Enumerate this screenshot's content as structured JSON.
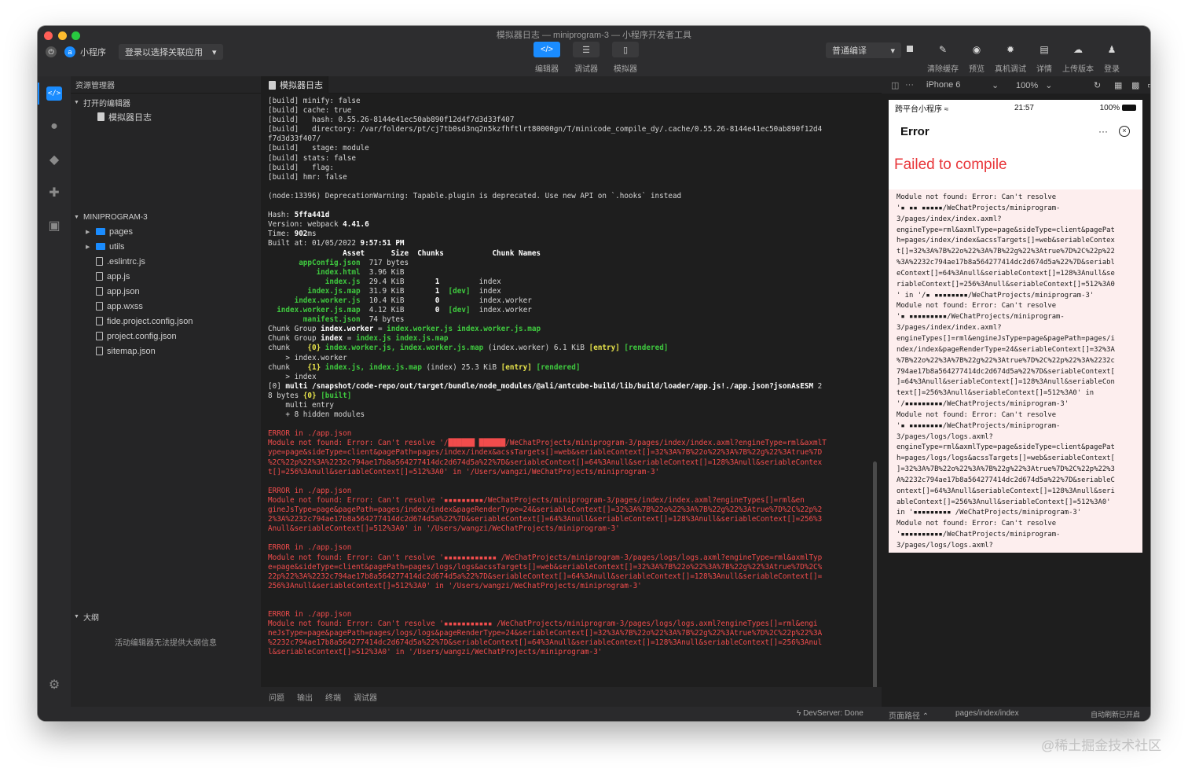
{
  "window": {
    "title": "模拟器日志 — miniprogram-3 — 小程序开发者工具"
  },
  "toolbar": {
    "app_label": "小程序",
    "project_select": "登录以选择关联应用",
    "modes": [
      {
        "icon": "code-icon",
        "label": "编辑器",
        "active": true
      },
      {
        "icon": "sliders-icon",
        "label": "调试器",
        "active": false
      },
      {
        "icon": "phone-icon",
        "label": "模拟器",
        "active": false
      }
    ],
    "compile_mode": "普通编译",
    "actions": [
      {
        "icon": "broom-icon",
        "label": "清除缓存"
      },
      {
        "icon": "eye-icon",
        "label": "预览"
      },
      {
        "icon": "bug-icon",
        "label": "真机调试"
      },
      {
        "icon": "document-icon",
        "label": "详情"
      },
      {
        "icon": "cloud-upload-icon",
        "label": "上传版本"
      },
      {
        "icon": "user-icon",
        "label": "登录"
      }
    ]
  },
  "explorer": {
    "header": "资源管理器",
    "open_editors_label": "打开的编辑器",
    "open_editors": [
      "模拟器日志"
    ],
    "project_label": "MINIPROGRAM-3",
    "files": [
      {
        "name": "pages",
        "type": "folder"
      },
      {
        "name": "utils",
        "type": "folder"
      },
      {
        "name": ".eslintrc.js",
        "type": "file"
      },
      {
        "name": "app.js",
        "type": "file"
      },
      {
        "name": "app.json",
        "type": "file"
      },
      {
        "name": "app.wxss",
        "type": "file"
      },
      {
        "name": "fide.project.config.json",
        "type": "file"
      },
      {
        "name": "project.config.json",
        "type": "file"
      },
      {
        "name": "sitemap.json",
        "type": "file"
      }
    ],
    "outline_label": "大纲",
    "outline_message": "活动编辑器无法提供大纲信息"
  },
  "editor": {
    "tab_label": "模拟器日志",
    "console_lines": [
      [
        {
          "t": "[build] minify: false"
        }
      ],
      [
        {
          "t": "[build] cache: true"
        }
      ],
      [
        {
          "t": "[build]   hash: 0.55.26-8144e41ec50ab890f12d4f7d3d33f407"
        }
      ],
      [
        {
          "t": "[build]   directory: /var/folders/pt/cj7tb0sd3nq2n5kzfhftlrt80000gn/T/minicode_compile_dy/.cache/0.55.26-8144e41ec50ab890f12d4"
        }
      ],
      [
        {
          "t": "f7d3d33f407/"
        }
      ],
      [
        {
          "t": "[build]   stage: module"
        }
      ],
      [
        {
          "t": "[build] stats: false"
        }
      ],
      [
        {
          "t": "[build]   flag:"
        }
      ],
      [
        {
          "t": "[build] hmr: false"
        }
      ],
      [
        {
          "t": ""
        }
      ],
      [
        {
          "t": "(node:13396) DeprecationWarning: Tapable.plugin is deprecated. Use new API on `.hooks` instead"
        }
      ],
      [
        {
          "t": ""
        }
      ],
      [
        {
          "t": "Hash: "
        },
        {
          "t": "5ffa441d",
          "c": "b"
        }
      ],
      [
        {
          "t": "Version: webpack "
        },
        {
          "t": "4.41.6",
          "c": "b"
        }
      ],
      [
        {
          "t": "Time: "
        },
        {
          "t": "902",
          "c": "b"
        },
        {
          "t": "ms"
        }
      ],
      [
        {
          "t": "Built at: 01/05/2022 "
        },
        {
          "t": "9:57:51 PM",
          "c": "b"
        }
      ],
      [
        {
          "t": "                 Asset      Size  Chunks           Chunk Names",
          "c": "b"
        }
      ],
      [
        {
          "t": "       "
        },
        {
          "t": "appConfig.json",
          "c": "green"
        },
        {
          "t": "  717 bytes"
        }
      ],
      [
        {
          "t": "           "
        },
        {
          "t": "index.html",
          "c": "green"
        },
        {
          "t": "  3.96 KiB"
        }
      ],
      [
        {
          "t": "             "
        },
        {
          "t": "index.js",
          "c": "green"
        },
        {
          "t": "  29.4 KiB       "
        },
        {
          "t": "1",
          "c": "b"
        },
        {
          "t": "         index"
        }
      ],
      [
        {
          "t": "         "
        },
        {
          "t": "index.js.map",
          "c": "green"
        },
        {
          "t": "  31.9 KiB       "
        },
        {
          "t": "1",
          "c": "b"
        },
        {
          "t": "  "
        },
        {
          "t": "[dev]",
          "c": "green"
        },
        {
          "t": "  index"
        }
      ],
      [
        {
          "t": "      "
        },
        {
          "t": "index.worker.js",
          "c": "green"
        },
        {
          "t": "  10.4 KiB       "
        },
        {
          "t": "0",
          "c": "b"
        },
        {
          "t": "         index.worker"
        }
      ],
      [
        {
          "t": "  "
        },
        {
          "t": "index.worker.js.map",
          "c": "green"
        },
        {
          "t": "  4.12 KiB       "
        },
        {
          "t": "0",
          "c": "b"
        },
        {
          "t": "  "
        },
        {
          "t": "[dev]",
          "c": "green"
        },
        {
          "t": "  index.worker"
        }
      ],
      [
        {
          "t": "        "
        },
        {
          "t": "manifest.json",
          "c": "green"
        },
        {
          "t": "  74 bytes"
        }
      ],
      [
        {
          "t": "Chunk Group "
        },
        {
          "t": "index.worker",
          "c": "b"
        },
        {
          "t": " = "
        },
        {
          "t": "index.worker.js index.worker.js.map",
          "c": "green"
        }
      ],
      [
        {
          "t": "Chunk Group "
        },
        {
          "t": "index",
          "c": "b"
        },
        {
          "t": " = "
        },
        {
          "t": "index.js index.js.map",
          "c": "green"
        }
      ],
      [
        {
          "t": "chunk    "
        },
        {
          "t": "{0}",
          "c": "yellow"
        },
        {
          "t": " "
        },
        {
          "t": "index.worker.js, index.worker.js.map",
          "c": "green"
        },
        {
          "t": " (index.worker) 6.1 KiB "
        },
        {
          "t": "[entry]",
          "c": "yellow"
        },
        {
          "t": " "
        },
        {
          "t": "[rendered]",
          "c": "green"
        }
      ],
      [
        {
          "t": "    > index.worker"
        }
      ],
      [
        {
          "t": "chunk    "
        },
        {
          "t": "{1}",
          "c": "yellow"
        },
        {
          "t": " "
        },
        {
          "t": "index.js, index.js.map",
          "c": "green"
        },
        {
          "t": " (index) 25.3 KiB "
        },
        {
          "t": "[entry]",
          "c": "yellow"
        },
        {
          "t": " "
        },
        {
          "t": "[rendered]",
          "c": "green"
        }
      ],
      [
        {
          "t": "    > index"
        }
      ],
      [
        {
          "t": "[0] "
        },
        {
          "t": "multi /snapshot/code-repo/out/target/bundle/node_modules/@ali/antcube-build/lib/build/loader/app.js!./app.json?jsonAsESM",
          "c": "b"
        },
        {
          "t": " 2"
        }
      ],
      [
        {
          "t": "8 bytes "
        },
        {
          "t": "{0}",
          "c": "yellow"
        },
        {
          "t": " "
        },
        {
          "t": "[built]",
          "c": "green"
        }
      ],
      [
        {
          "t": "    multi entry"
        }
      ],
      [
        {
          "t": "    + 8 hidden modules"
        }
      ],
      [
        {
          "t": ""
        }
      ],
      [
        {
          "t": "ERROR in ./app.json",
          "c": "red"
        }
      ],
      [
        {
          "t": "Module not found: Error: Can't resolve '/██████ ██████/WeChatProjects/miniprogram-3/pages/index/index.axml?engineType=rml&axmlT",
          "c": "red"
        }
      ],
      [
        {
          "t": "ype=page&sideType=client&pagePath=pages/index/index&acssTargets[]=web&seriableContext[]=32%3A%7B%22o%22%3A%7B%22g%22%3Atrue%7D",
          "c": "red"
        }
      ],
      [
        {
          "t": "%2C%22p%22%3A%2232c794ae17b8a564277414dc2d674d5a%22%7D&seriableContext[]=64%3Anull&seriableContext[]=128%3Anull&seriableContex",
          "c": "red"
        }
      ],
      [
        {
          "t": "t[]=256%3Anull&seriableContext[]=512%3A0' in '/Users/wangzi/WeChatProjects/miniprogram-3'",
          "c": "red"
        }
      ],
      [
        {
          "t": ""
        }
      ],
      [
        {
          "t": "ERROR in ./app.json",
          "c": "red"
        }
      ],
      [
        {
          "t": "Module not found: Error: Can't resolve '▪▪▪▪▪▪▪▪▪/WeChatProjects/miniprogram-3/pages/index/index.axml?engineTypes[]=rml&en",
          "c": "red"
        }
      ],
      [
        {
          "t": "gineJsType=page&pagePath=pages/index/index&pageRenderType=24&seriableContext[]=32%3A%7B%22o%22%3A%7B%22g%22%3Atrue%7D%2C%22p%2",
          "c": "red"
        }
      ],
      [
        {
          "t": "2%3A%2232c794ae17b8a564277414dc2d674d5a%22%7D&seriableContext[]=64%3Anull&seriableContext[]=128%3Anull&seriableContext[]=256%3",
          "c": "red"
        }
      ],
      [
        {
          "t": "Anull&seriableContext[]=512%3A0' in '/Users/wangzi/WeChatProjects/miniprogram-3'",
          "c": "red"
        }
      ],
      [
        {
          "t": ""
        }
      ],
      [
        {
          "t": "ERROR in ./app.json",
          "c": "red"
        }
      ],
      [
        {
          "t": "Module not found: Error: Can't resolve '▪▪▪▪▪▪▪▪▪▪▪▪ /WeChatProjects/miniprogram-3/pages/logs/logs.axml?engineType=rml&axmlTyp",
          "c": "red"
        }
      ],
      [
        {
          "t": "e=page&sideType=client&pagePath=pages/logs/logs&acssTargets[]=web&seriableContext[]=32%3A%7B%22o%22%3A%7B%22g%22%3Atrue%7D%2C%",
          "c": "red"
        }
      ],
      [
        {
          "t": "22p%22%3A%2232c794ae17b8a564277414dc2d674d5a%22%7D&seriableContext[]=64%3Anull&seriableContext[]=128%3Anull&seriableContext[]=",
          "c": "red"
        }
      ],
      [
        {
          "t": "256%3Anull&seriableContext[]=512%3A0' in '/Users/wangzi/WeChatProjects/miniprogram-3'",
          "c": "red"
        }
      ],
      [
        {
          "t": ""
        }
      ],
      [
        {
          "t": ""
        }
      ],
      [
        {
          "t": "ERROR in ./app.json",
          "c": "red"
        }
      ],
      [
        {
          "t": "Module not found: Error: Can't resolve '▪▪▪▪▪▪▪▪▪▪▪ /WeChatProjects/miniprogram-3/pages/logs/logs.axml?engineTypes[]=rml&engi",
          "c": "red"
        }
      ],
      [
        {
          "t": "neJsType=page&pagePath=pages/logs/logs&pageRenderType=24&seriableContext[]=32%3A%7B%22o%22%3A%7B%22g%22%3Atrue%7D%2C%22p%22%3A",
          "c": "red"
        }
      ],
      [
        {
          "t": "%2232c794ae17b8a564277414dc2d674d5a%22%7D&seriableContext[]=64%3Anull&seriableContext[]=128%3Anull&seriableContext[]=256%3Anul",
          "c": "red"
        }
      ],
      [
        {
          "t": "l&seriableContext[]=512%3A0' in '/Users/wangzi/WeChatProjects/miniprogram-3'",
          "c": "red"
        }
      ]
    ]
  },
  "panel_tabs": [
    "问题",
    "输出",
    "终端",
    "调试器"
  ],
  "simulator": {
    "device": "iPhone 6",
    "zoom": "100%",
    "status_carrier": "跨平台小程序",
    "status_time": "21:57",
    "status_battery": "100%",
    "nav_title": "Error",
    "error_heading": "Failed to compile",
    "error_lines": [
      "Module not found: Error: Can't resolve",
      "'▪ ▪▪ ▪▪▪▪▪/WeChatProjects/miniprogram-",
      "3/pages/index/index.axml?",
      "engineType=rml&axmlType=page&sideType=client&pagePat",
      "h=pages/index/index&acssTargets[]=web&seriableContex",
      "t[]=32%3A%7B%22o%22%3A%7B%22g%22%3Atrue%7D%2C%22p%22",
      "%3A%2232c794ae17b8a564277414dc2d674d5a%22%7D&seriabl",
      "eContext[]=64%3Anull&seriableContext[]=128%3Anull&se",
      "riableContext[]=256%3Anull&seriableContext[]=512%3A0",
      "' in '/▪ ▪▪▪▪▪▪▪▪/WeChatProjects/miniprogram-3'",
      "Module not found: Error: Can't resolve",
      "'▪ ▪▪▪▪▪▪▪▪▪/WeChatProjects/miniprogram-",
      "3/pages/index/index.axml?",
      "engineTypes[]=rml&engineJsType=page&pagePath=pages/i",
      "ndex/index&pageRenderType=24&seriableContext[]=32%3A",
      "%7B%22o%22%3A%7B%22g%22%3Atrue%7D%2C%22p%22%3A%2232c",
      "794ae17b8a564277414dc2d674d5a%22%7D&seriableContext[",
      "]=64%3Anull&seriableContext[]=128%3Anull&seriableCon",
      "text[]=256%3Anull&seriableContext[]=512%3A0' in",
      "'/▪▪▪▪▪▪▪▪▪/WeChatProjects/miniprogram-3'",
      "Module not found: Error: Can't resolve",
      "'▪ ▪▪▪▪▪▪▪▪/WeChatProjects/miniprogram-",
      "3/pages/logs/logs.axml?",
      "engineType=rml&axmlType=page&sideType=client&pagePat",
      "h=pages/logs/logs&acssTargets[]=web&seriableContext[",
      "]=32%3A%7B%22o%22%3A%7B%22g%22%3Atrue%7D%2C%22p%22%3",
      "A%2232c794ae17b8a564277414dc2d674d5a%22%7D&seriableC",
      "ontext[]=64%3Anull&seriableContext[]=128%3Anull&seri",
      "ableContext[]=256%3Anull&seriableContext[]=512%3A0'",
      "in '▪▪▪▪▪▪▪▪▪ /WeChatProjects/miniprogram-3'",
      "Module not found: Error: Can't resolve",
      "'▪▪▪▪▪▪▪▪▪▪/WeChatProjects/miniprogram-",
      "3/pages/logs/logs.axml?"
    ]
  },
  "statusbar": {
    "devserver": "DevServer: Done",
    "page_path_label": "页面路径",
    "page_path": "pages/index/index",
    "auto_refresh": "自动刷新已开启"
  },
  "watermark": "@稀土掘金技术社区"
}
